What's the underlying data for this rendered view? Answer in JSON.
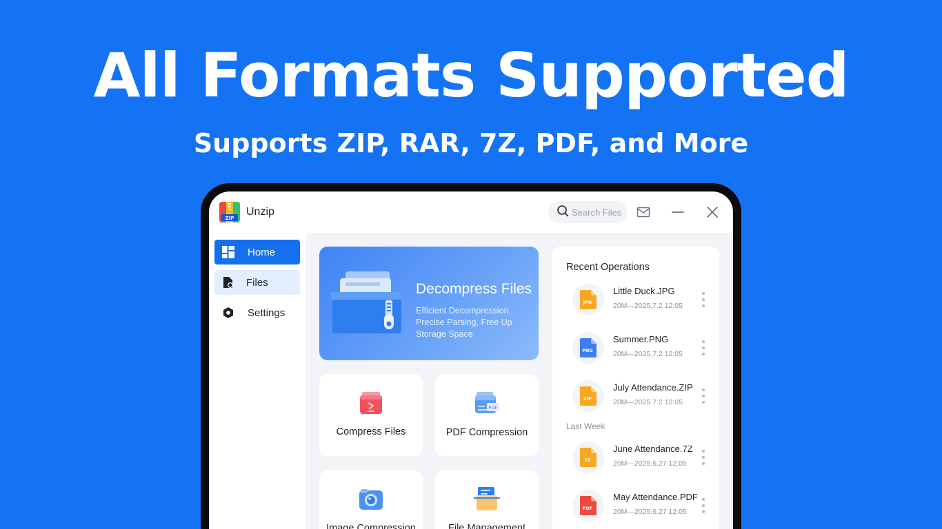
{
  "banner": {
    "title": "All Formats Supported",
    "subtitle": "Supports ZIP, RAR, 7Z, PDF, and More"
  },
  "app": {
    "name": "Unzip",
    "logo_text": "ZIP",
    "search_placeholder": "Search Files"
  },
  "sidebar": {
    "items": [
      {
        "label": "Home",
        "active": true
      },
      {
        "label": "Files",
        "active": false
      },
      {
        "label": "Settings",
        "active": false
      }
    ]
  },
  "hero": {
    "title": "Decompress Files",
    "description": "Efficient Decompression, Precise Parsing, Free Up Storage Space"
  },
  "tiles": [
    {
      "label": "Compress Files",
      "icon": "compress-files-icon"
    },
    {
      "label": "PDF Compression",
      "icon": "pdf-compression-icon",
      "icon_text": "PDF"
    },
    {
      "label": "Image Compression",
      "icon": "image-compression-icon"
    },
    {
      "label": "File Management",
      "icon": "file-management-icon"
    }
  ],
  "recent": {
    "title": "Recent Operations",
    "group_label": "Last Week",
    "items": [
      {
        "name": "Little Duck.JPG",
        "meta": "20M—2025.7.2 12:05",
        "badge": "JPG",
        "color": "#f7a823"
      },
      {
        "name": "Summer.PNG",
        "meta": "20M—2025.7.2 12:05",
        "badge": "PNG",
        "color": "#3f7df0"
      },
      {
        "name": "July Attendance.ZIP",
        "meta": "20M—2025.7.2 12:05",
        "badge": "ZIP",
        "color": "#f7a823"
      },
      {
        "name": "June Attendance.7Z",
        "meta": "20M—2025.6.27 12:05",
        "badge": "7Z",
        "color": "#f7a823"
      },
      {
        "name": "May Attendance.PDF",
        "meta": "20M—2025.6.27 12:05",
        "badge": "PDF",
        "color": "#ef4a3d"
      }
    ]
  },
  "colors": {
    "background": "#1473f5",
    "accent": "#1570ef",
    "active_nav_bg": "#1570ef",
    "hover_nav_bg": "#e2eefd"
  }
}
